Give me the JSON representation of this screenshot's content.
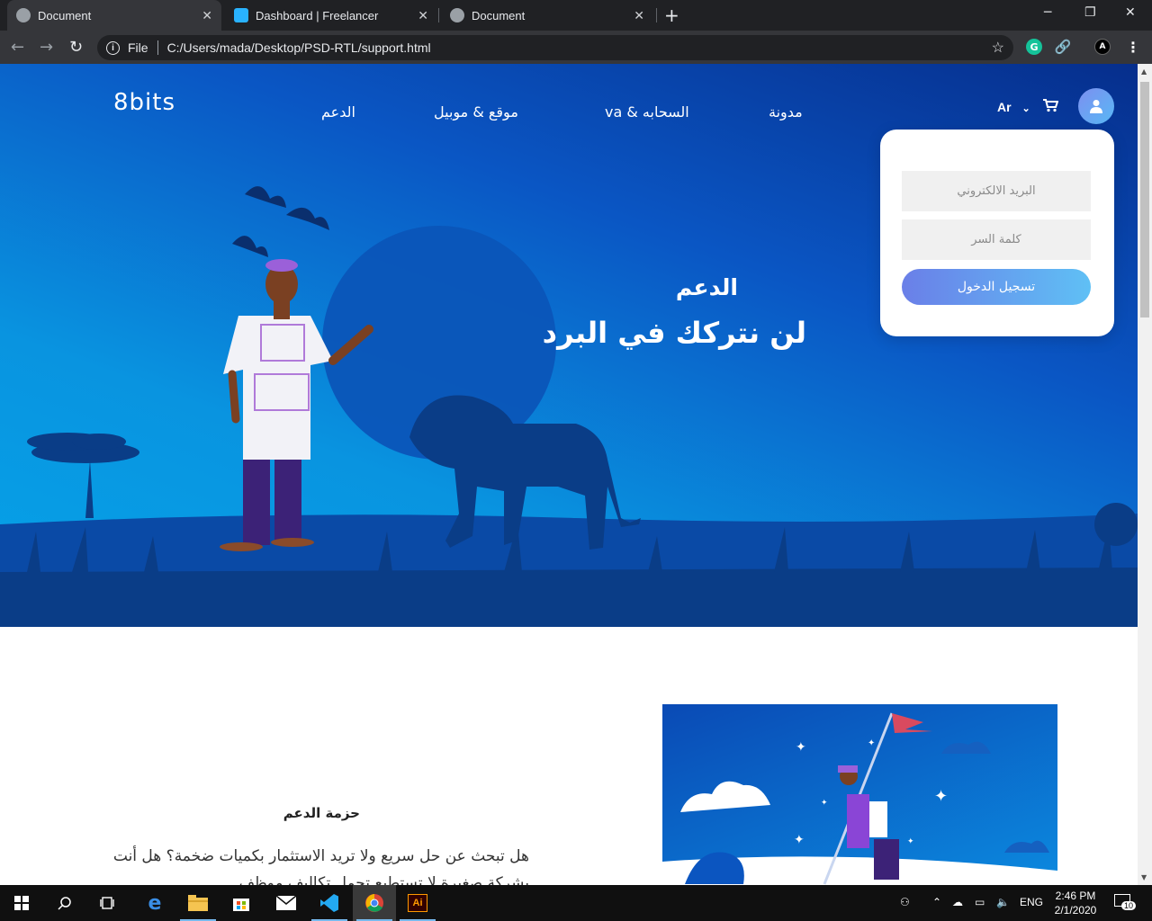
{
  "browser": {
    "tabs": [
      {
        "title": "Document",
        "active": true,
        "favicon": "globe-icon"
      },
      {
        "title": "Dashboard | Freelancer",
        "active": false,
        "favicon": "freelancer-bird-icon"
      },
      {
        "title": "Document",
        "active": false,
        "favicon": "globe-icon"
      }
    ],
    "new_tab": "+",
    "address": {
      "scheme": "File",
      "url": "C:/Users/mada/Desktop/PSD-RTL/support.html"
    },
    "extensions": [
      "grammarly-icon",
      "link-icon",
      "profile-icon"
    ]
  },
  "header": {
    "logo": "8bits",
    "nav": [
      {
        "label": "مدونة"
      },
      {
        "label": "va & السحابه"
      },
      {
        "label": "موقع & موبيل"
      },
      {
        "label": "الدعم"
      }
    ],
    "language": "Ar",
    "cart_icon": "cart-icon",
    "user_icon": "user-icon"
  },
  "login": {
    "email_placeholder": "البريد الالكتروني",
    "password_placeholder": "كلمة السر",
    "submit_label": "تسجيل الدخول"
  },
  "hero": {
    "title": "الدعم",
    "subtitle": "لن نتركك في البرد"
  },
  "content": {
    "title": "حزمة الدعم",
    "paragraph": "هل تبحث عن حل سريع ولا تريد الاستثمار بكميات ضخمة؟ هل أنت بشركة صغيرة لا تستطيع تحمل تكاليف موظف"
  },
  "taskbar": {
    "apps": [
      "start-icon",
      "search-icon",
      "task-view-icon",
      "edge-icon",
      "file-explorer-icon",
      "store-icon",
      "mail-icon",
      "vscode-icon",
      "chrome-icon",
      "illustrator-icon"
    ],
    "language": "ENG",
    "time": "2:46 PM",
    "date": "2/1/2020",
    "notifications": "10"
  },
  "colors": {
    "hero_dark": "#062e8c",
    "hero_light": "#05a3e8",
    "button_gradient_start": "#6a7fe8",
    "button_gradient_end": "#5fc0f5"
  }
}
